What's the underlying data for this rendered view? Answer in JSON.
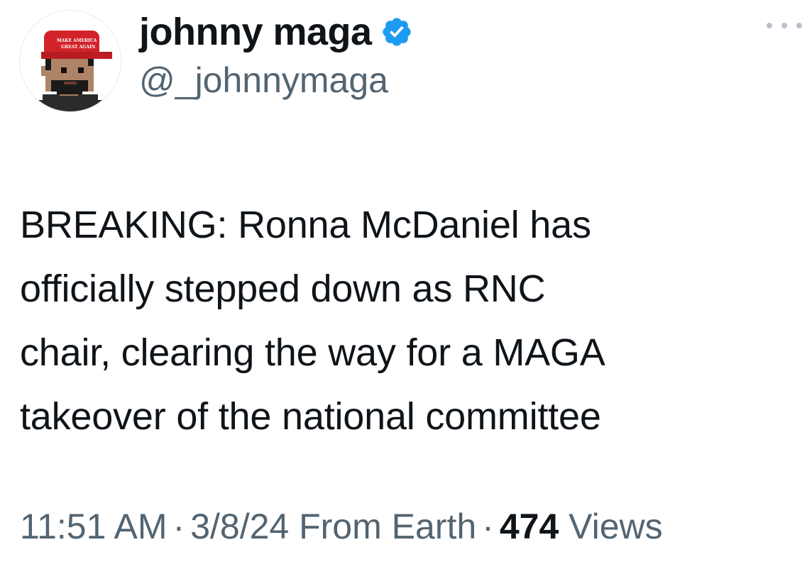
{
  "author": {
    "display_name": "johnny maga",
    "handle": "@_johnnymaga",
    "verified": true,
    "avatar_icon": "pixel-avatar-red-cap-icon",
    "avatar_cap_text": "MAKE AMERICA GREAT AGAIN"
  },
  "tweet": {
    "lines": [
      "BREAKING: Ronna McDaniel has",
      "officially stepped down as RNC",
      "chair, clearing the way for a MAGA",
      "takeover of the national committee"
    ]
  },
  "meta": {
    "time": "11:51 AM",
    "separator": "·",
    "date_source": "3/8/24 From Earth",
    "views_count": "474",
    "views_label": "Views"
  },
  "colors": {
    "verified_blue": "#1d9bf0",
    "text_primary": "#0f1419",
    "text_secondary": "#536471",
    "cap_red": "#d2232a"
  }
}
